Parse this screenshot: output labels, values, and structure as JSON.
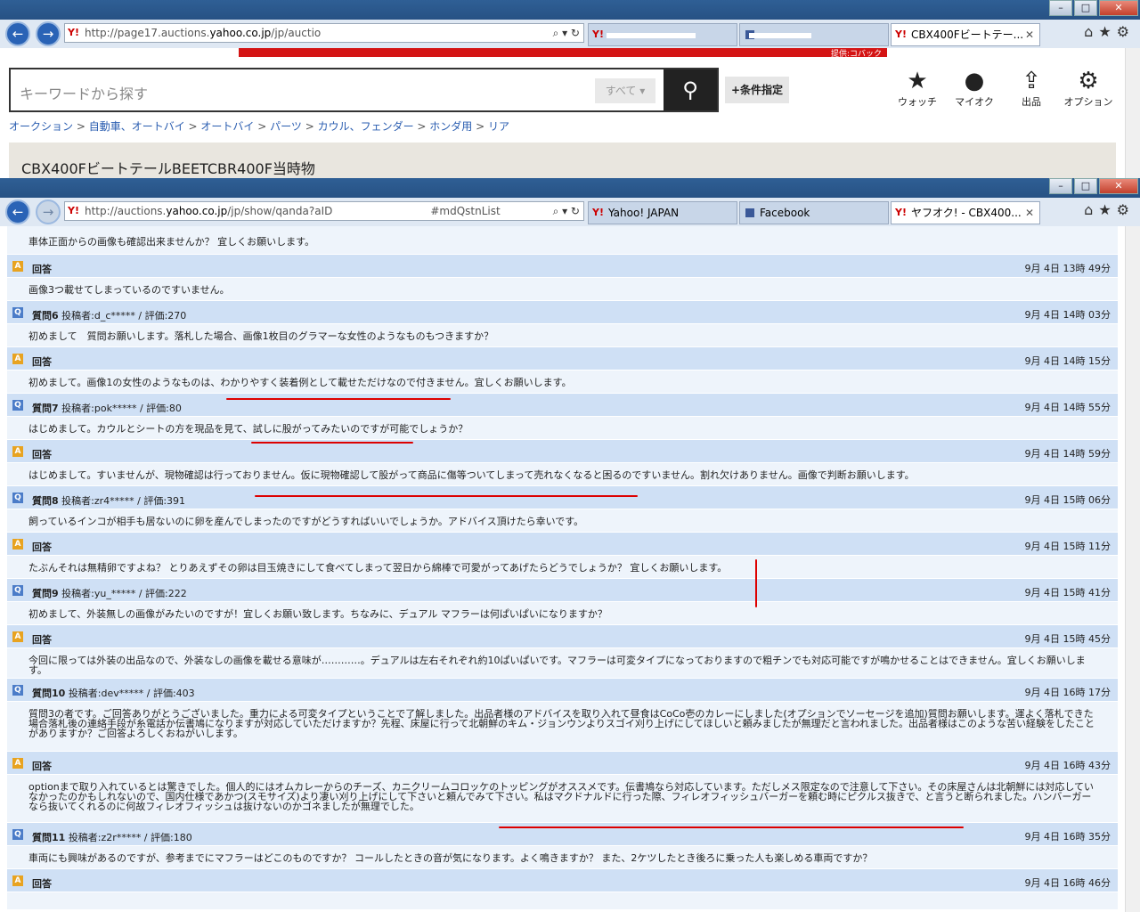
{
  "windows": [
    {
      "url_prefix": "http://page17.auctions.",
      "url_domain": "yahoo.co.jp",
      "url_suffix": "/jp/auctio",
      "tabs": [
        {
          "label": ""
        },
        {
          "label": ""
        },
        {
          "label": "CBX400Fビートテー..."
        }
      ]
    },
    {
      "url_prefix": "http://auctions.",
      "url_domain": "yahoo.co.jp",
      "url_suffix": "/jp/show/qanda?aID",
      "url_tail": "#mdQstnList",
      "tabs": [
        {
          "label": "Yahoo! JAPAN"
        },
        {
          "label": "Facebook"
        },
        {
          "label": "ヤフオク! - CBX400..."
        }
      ]
    }
  ],
  "search": {
    "placeholder": "キーワードから探す",
    "category": "すべて",
    "condition_button": "+条件指定"
  },
  "header_icons": [
    {
      "label": "ウォッチ",
      "icon": "star-icon"
    },
    {
      "label": "マイオク",
      "icon": "person-icon"
    },
    {
      "label": "出品",
      "icon": "upload-icon"
    },
    {
      "label": "オプション",
      "icon": "gear-icon"
    }
  ],
  "ad": {
    "text": "提供:コバック"
  },
  "breadcrumb": [
    "オークション",
    "自動車、オートバイ",
    "オートバイ",
    "パーツ",
    "カウル、フェンダー",
    "ホンダ用",
    "リア"
  ],
  "item_title": "CBX400FビートテールBEETCBR400F当時物",
  "qa": {
    "partial_first": "車体正面からの画像も確認出来ませんか？ 宜しくお願いします。",
    "rows": [
      {
        "type": "A",
        "head": "回答",
        "date": "9月 4日 13時 49分",
        "text": "画像3つ載せてしまっているのですいません。"
      },
      {
        "type": "Q",
        "head": "質問6",
        "poster": "投稿者:d_c***** / 評価:270",
        "date": "9月 4日 14時 03分",
        "text": "初めまして　質問お願いします。落札した場合、画像1枚目のグラマーな女性のようなものもつきますか？"
      },
      {
        "type": "A",
        "head": "回答",
        "date": "9月 4日 14時 15分",
        "text": "初めまして。画像1の女性のようなものは、わかりやすく装着例として載せただけなので付きません。宜しくお願いします。"
      },
      {
        "type": "Q",
        "head": "質問7",
        "poster": "投稿者:pok***** / 評価:80",
        "date": "9月 4日 14時 55分",
        "text": "はじめまして。カウルとシートの方を現品を見て、試しに股がってみたいのですが可能でしょうか？"
      },
      {
        "type": "A",
        "head": "回答",
        "date": "9月 4日 14時 59分",
        "text": "はじめまして。すいませんが、現物確認は行っておりません。仮に現物確認して股がって商品に傷等ついてしまって売れなくなると困るのですいません。割れ欠けありません。画像で判断お願いします。"
      },
      {
        "type": "Q",
        "head": "質問8",
        "poster": "投稿者:zr4***** / 評価:391",
        "date": "9月 4日 15時 06分",
        "text": "飼っているインコが相手も居ないのに卵を産んでしまったのですがどうすればいいでしょうか。アドバイス頂けたら幸いです。"
      },
      {
        "type": "A",
        "head": "回答",
        "date": "9月 4日 15時 11分",
        "text": "たぶんそれは無精卵ですよね？ とりあえずその卵は目玉焼きにして食べてしまって翌日から綿棒で可愛がってあげたらどうでしょうか？ 宜しくお願いします。"
      },
      {
        "type": "Q",
        "head": "質問9",
        "poster": "投稿者:yu_***** / 評価:222",
        "date": "9月 4日 15時 41分",
        "text": "初めまして、外装無しの画像がみたいのですが！宜しくお願い致します。ちなみに、デュアル マフラーは何ぱいぱいになりますか？"
      },
      {
        "type": "A",
        "head": "回答",
        "date": "9月 4日 15時 45分",
        "text": "今回に限っては外装の出品なので、外装なしの画像を載せる意味が…………。デュアルは左右それぞれ約10ぱいぱいです。マフラーは可変タイプになっておりますので粗チンでも対応可能ですが鳴かせることはできません。宜しくお願いします。"
      },
      {
        "type": "Q",
        "head": "質問10",
        "poster": "投稿者:dev***** / 評価:403",
        "date": "9月 4日 16時 17分",
        "text": "質問3の者です。ご回答ありがとうございました。重力による可変タイプということで了解しました。出品者様のアドバイスを取り入れて昼食はCoCo壱のカレーにしました(オプションでソーセージを追加)質問お願いします。運よく落札できた場合落札後の連絡手段が糸電話か伝書鳩になりますが対応していただけますか？先程、床屋に行って北朝鮮のキム・ジョンウンよりスゴイ刈り上げにしてほしいと頼みましたが無理だと言われました。出品者様はこのような苦い経験をしたことがありますか？ご回答よろしくおねがいします。"
      },
      {
        "type": "A",
        "head": "回答",
        "date": "9月 4日 16時 43分",
        "text": "optionまで取り入れているとは驚きでした。個人的にはオムカレーからのチーズ、カニクリームコロッケのトッピングがオススメです。伝書鳩なら対応しています。ただしメス限定なので注意して下さい。その床屋さんは北朝鮮には対応していなかったのかもしれないので、国内仕様であかつ(スモサイズ)より凄い刈り上げにして下さいと頼んでみて下さい。私はマクドナルドに行った際、フィレオフィッシュバーガーを頼む時にピクルス抜きで、と言うと断られました。ハンバーガーなら抜いてくれるのに何故フィレオフィッシュは抜けないのかゴネましたが無理でした。"
      },
      {
        "type": "Q",
        "head": "質問11",
        "poster": "投稿者:z2r***** / 評価:180",
        "date": "9月 4日 16時 35分",
        "text": "車両にも興味があるのですが、参考までにマフラーはどこのものですか？ コールしたときの音が気になります。よく鳴きますか？ また、2ケツしたとき後ろに乗った人も楽しめる車両ですか？"
      },
      {
        "type": "A",
        "head": "回答",
        "date": "9月 4日 16時 46分",
        "text": ""
      }
    ]
  }
}
